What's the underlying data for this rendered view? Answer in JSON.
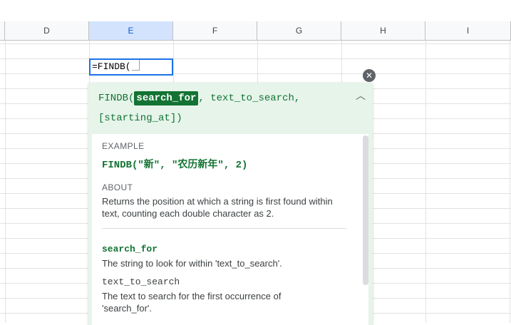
{
  "columns": [
    {
      "label": "D",
      "selected": false
    },
    {
      "label": "E",
      "selected": true
    },
    {
      "label": "F",
      "selected": false
    },
    {
      "label": "G",
      "selected": false
    },
    {
      "label": "H",
      "selected": false
    },
    {
      "label": "I",
      "selected": false
    }
  ],
  "cell_editor": {
    "value": "=FINDB("
  },
  "help": {
    "signature": {
      "prefix": "FINDB(",
      "active_arg": "search_for",
      "rest_line1": ", text_to_search,",
      "line2": "[starting_at])"
    },
    "example_label": "EXAMPLE",
    "example_code": "FINDB(\"新\", \"农历新年\", 2)",
    "about_label": "ABOUT",
    "about_text": "Returns the position at which a string is first found within text, counting each double character as 2.",
    "args": [
      {
        "name": "search_for",
        "desc": "The string to look for within 'text_to_search'."
      },
      {
        "name": "text_to_search",
        "desc": "The text to search for the first occurrence of 'search_for'."
      }
    ],
    "close_glyph": "✕",
    "collapse_glyph": "︿"
  },
  "colors": {
    "accent_green": "#137333",
    "card_bg": "#e6f4ea",
    "selection_blue": "#1a73e8"
  }
}
